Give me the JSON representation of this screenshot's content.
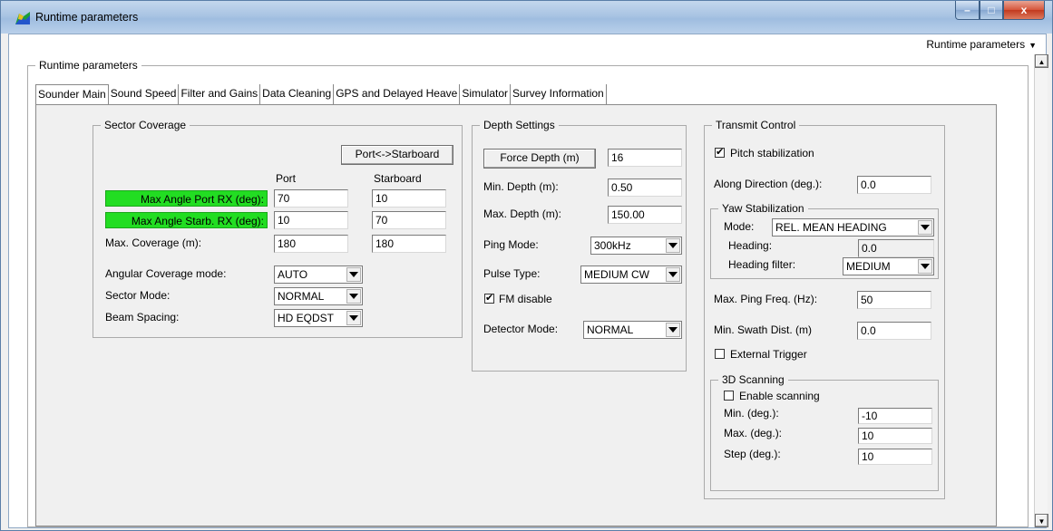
{
  "window": {
    "title": "Runtime parameters",
    "min_label": "–",
    "max_label": "□",
    "close_label": "x"
  },
  "top_dropdown": {
    "label": "Runtime parameters",
    "arrow": "▼"
  },
  "outer_group": {
    "title": "Runtime parameters"
  },
  "tabs": [
    {
      "label": "Sounder Main"
    },
    {
      "label": "Sound Speed"
    },
    {
      "label": "Filter and Gains"
    },
    {
      "label": "Data Cleaning"
    },
    {
      "label": "GPS and Delayed Heave"
    },
    {
      "label": "Simulator"
    },
    {
      "label": "Survey Information"
    }
  ],
  "sector": {
    "title": "Sector Coverage",
    "swap_button": "Port<->Starboard",
    "col_port": "Port",
    "col_starboard": "Starboard",
    "max_angle_port_btn": "Max Angle Port RX (deg):",
    "max_angle_starb_btn": "Max Angle Starb. RX (deg):",
    "max_coverage_label": "Max. Coverage (m):",
    "port_rx_port": "70",
    "port_rx_starb": "10",
    "starb_rx_port": "10",
    "starb_rx_starb": "70",
    "coverage_port": "180",
    "coverage_starb": "180",
    "angular_mode_label": "Angular Coverage mode:",
    "angular_mode_value": "AUTO",
    "sector_mode_label": "Sector Mode:",
    "sector_mode_value": "NORMAL",
    "beam_spacing_label": "Beam Spacing:",
    "beam_spacing_value": "HD EQDST"
  },
  "depth": {
    "title": "Depth Settings",
    "force_depth_btn": "Force Depth (m)",
    "force_depth_value": "16",
    "min_depth_label": "Min. Depth (m):",
    "min_depth_value": "0.50",
    "max_depth_label": "Max. Depth (m):",
    "max_depth_value": "150.00",
    "ping_mode_label": "Ping Mode:",
    "ping_mode_value": "300kHz",
    "pulse_type_label": "Pulse Type:",
    "pulse_type_value": "MEDIUM CW",
    "fm_disable_label": "FM disable",
    "fm_disable_checked": "✔",
    "detector_mode_label": "Detector Mode:",
    "detector_mode_value": "NORMAL"
  },
  "transmit": {
    "title": "Transmit Control",
    "pitch_label": "Pitch stabilization",
    "pitch_checked": "✔",
    "along_label": "Along Direction (deg.):",
    "along_value": "0.0",
    "yaw_title": "Yaw Stabilization",
    "yaw_mode_label": "Mode:",
    "yaw_mode_value": "REL. MEAN HEADING",
    "heading_label": "Heading:",
    "heading_value": "0.0",
    "heading_filter_label": "Heading filter:",
    "heading_filter_value": "MEDIUM",
    "max_ping_label": "Max. Ping Freq. (Hz):",
    "max_ping_value": "50",
    "min_swath_label": "Min. Swath Dist. (m)",
    "min_swath_value": "0.0",
    "ext_trigger_label": "External Trigger",
    "scan_title": "3D Scanning",
    "enable_scan_label": "Enable scanning",
    "scan_min_label": "Min. (deg.):",
    "scan_min_value": "-10",
    "scan_max_label": "Max. (deg.):",
    "scan_max_value": "10",
    "scan_step_label": "Step (deg.):",
    "scan_step_value": "10"
  }
}
